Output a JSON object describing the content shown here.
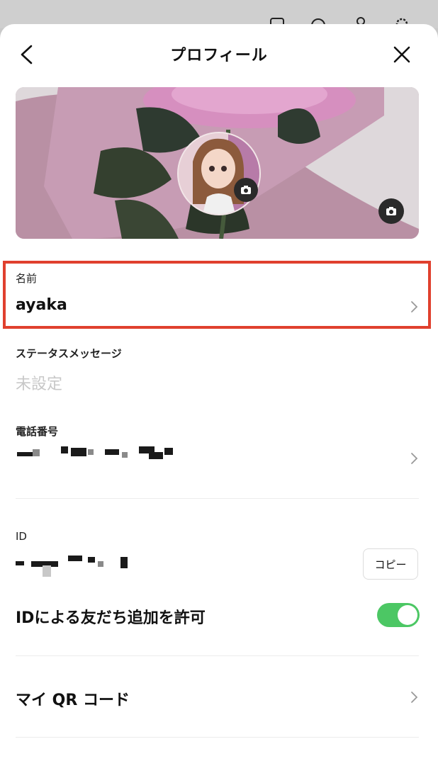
{
  "header": {
    "title": "プロフィール"
  },
  "fields": {
    "name": {
      "label": "名前",
      "value": "ayaka"
    },
    "status": {
      "label": "ステータスメッセージ",
      "value": "未設定"
    },
    "phone": {
      "label": "電話番号"
    },
    "id": {
      "label": "ID",
      "copy_label": "コピー"
    },
    "allow_id": {
      "label": "IDによる友だち追加を許可",
      "enabled": true
    },
    "qr": {
      "label": "マイ QR コード"
    }
  },
  "icons": {
    "back": "chevron-left-icon",
    "close": "close-icon",
    "camera": "camera-icon",
    "chevron": "chevron-right-icon"
  },
  "colors": {
    "toggle_on": "#4cc764",
    "highlight": "#e0402e"
  }
}
